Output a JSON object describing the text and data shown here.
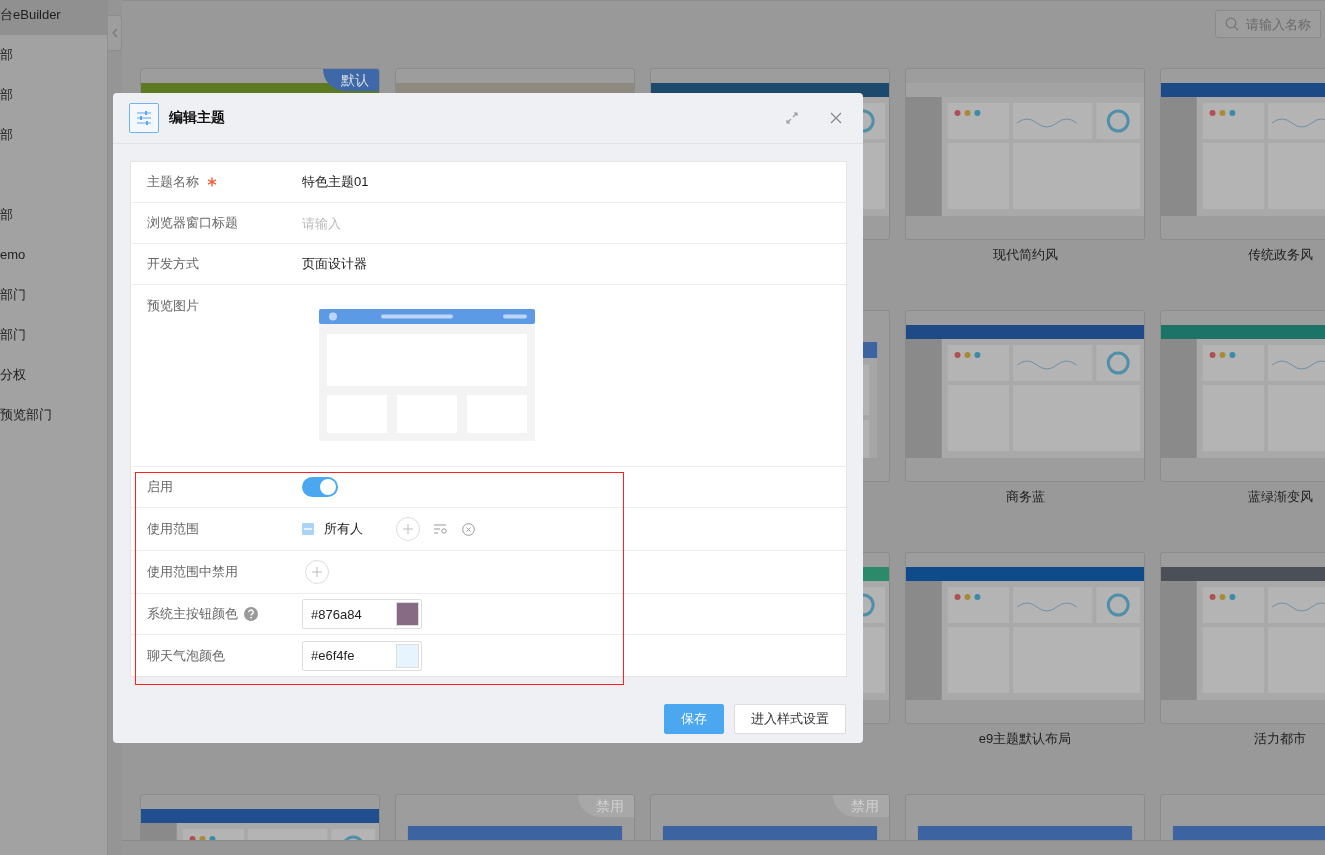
{
  "sidebar": {
    "items": [
      {
        "label": "台eBuilder",
        "selected": true
      },
      {
        "label": "部",
        "selected": false
      },
      {
        "label": "部",
        "selected": false
      },
      {
        "label": "部",
        "selected": false
      },
      {
        "label": "部",
        "selected": false
      },
      {
        "label": "emo",
        "selected": false
      },
      {
        "label": "部门",
        "selected": false
      },
      {
        "label": "部门",
        "selected": false
      },
      {
        "label": "分权",
        "selected": false
      },
      {
        "label": "预览部门",
        "selected": false
      }
    ]
  },
  "search": {
    "placeholder": "请输入名称"
  },
  "cards": [
    {
      "kind": "screenshot_top",
      "color": "#5d7a22",
      "badge": {
        "text": "默认",
        "kind": "default"
      }
    },
    {
      "kind": "screenshot_top",
      "color": "#8f8a80"
    },
    {
      "kind": "screenshot",
      "color": "#1d4a6c"
    },
    {
      "kind": "screenshot",
      "color": "#a3a3a3",
      "label": "现代简约风"
    },
    {
      "kind": "screenshot",
      "color": "#1b4a86",
      "label": "传统政务风"
    },
    {
      "kind": "covered"
    },
    {
      "kind": "covered"
    },
    {
      "kind": "layout",
      "color": "#3d64a0"
    },
    {
      "kind": "screenshot",
      "color": "#1f4a88",
      "label": "商务蓝"
    },
    {
      "kind": "screenshot",
      "color": "#1c7468",
      "label": "蓝绿渐变风"
    },
    {
      "kind": "covered"
    },
    {
      "kind": "covered"
    },
    {
      "kind": "screenshot",
      "color": "#2a8a6a"
    },
    {
      "kind": "screenshot",
      "color": "#0f4a8a",
      "label": "e9主题默认布局"
    },
    {
      "kind": "screenshot",
      "color": "#4a4f58",
      "label": "活力都市"
    },
    {
      "kind": "screenshot",
      "color": "#1f4f8f"
    },
    {
      "kind": "layout_top",
      "color": "#3d64a0",
      "badge": {
        "text": "禁用",
        "kind": "disabled"
      }
    },
    {
      "kind": "layout_top",
      "color": "#3d64a0",
      "badge": {
        "text": "禁用",
        "kind": "disabled"
      }
    },
    {
      "kind": "layout_top",
      "color": "#3d64a0"
    },
    {
      "kind": "layout_top",
      "color": "#3d64a0"
    }
  ],
  "dialog": {
    "title": "编辑主题",
    "fields": [
      {
        "kind": "text",
        "label": "主题名称",
        "required": true,
        "value": "特色主题01"
      },
      {
        "kind": "input",
        "label": "浏览器窗口标题",
        "placeholder": "请输入"
      },
      {
        "kind": "text",
        "label": "开发方式",
        "value": "页面设计器"
      },
      {
        "kind": "image",
        "label": "预览图片"
      },
      {
        "kind": "toggle",
        "label": "启用",
        "on": true
      },
      {
        "kind": "scope",
        "label": "使用范围",
        "value": "所有人"
      },
      {
        "kind": "add",
        "label": "使用范围中禁用"
      },
      {
        "kind": "color",
        "label": "系统主按钮颜色",
        "help": true,
        "value": "#876a84",
        "color": "#876a84"
      },
      {
        "kind": "color",
        "label": "聊天气泡颜色",
        "value": "#e6f4fe",
        "color": "#e6f4fe"
      }
    ],
    "buttons": [
      {
        "label": "保存",
        "kind": "primary"
      },
      {
        "label": "进入样式设置",
        "kind": "default"
      }
    ]
  }
}
